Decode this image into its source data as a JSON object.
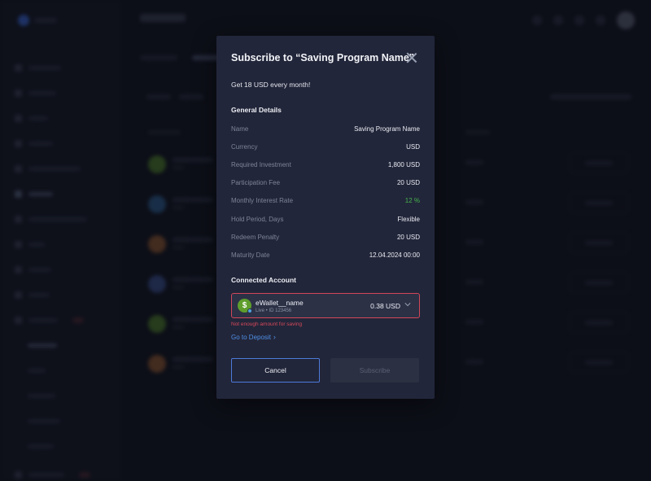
{
  "modal": {
    "title": "Subscribe to “Saving Program Name”",
    "subtitle": "Get 18 USD every month!",
    "general_details_title": "General Details",
    "details": [
      {
        "label": "Name",
        "value": "Saving Program Name"
      },
      {
        "label": "Currency",
        "value": "USD"
      },
      {
        "label": "Required Investment",
        "value": "1,800 USD"
      },
      {
        "label": "Participation Fee",
        "value": "20 USD"
      },
      {
        "label": "Monthly Interest Rate",
        "value": "12 %"
      },
      {
        "label": "Hold Period, Days",
        "value": "Flexible"
      },
      {
        "label": "Redeem Penalty",
        "value": "20 USD"
      },
      {
        "label": "Maturity Date",
        "value": "12.04.2024 00:00"
      }
    ],
    "connected_account_title": "Connected Account",
    "account": {
      "icon_glyph": "$",
      "name": "eWallet__name",
      "sub": "Live • ID 123456",
      "amount": "0.38 USD"
    },
    "error_text": "Not enough amount for saving",
    "deposit_link": "Go to Deposit",
    "cancel_label": "Cancel",
    "subscribe_label": "Subscribe"
  },
  "colors": {
    "accent": "#4d7ad9",
    "error": "#d8485b",
    "positive": "#45b54c",
    "modal_bg": "#22263a",
    "page_bg": "#141722"
  },
  "icons": [
    "close-icon",
    "dollar-icon",
    "live-status-dot-icon",
    "chevron-down-icon",
    "chevron-right-icon"
  ]
}
